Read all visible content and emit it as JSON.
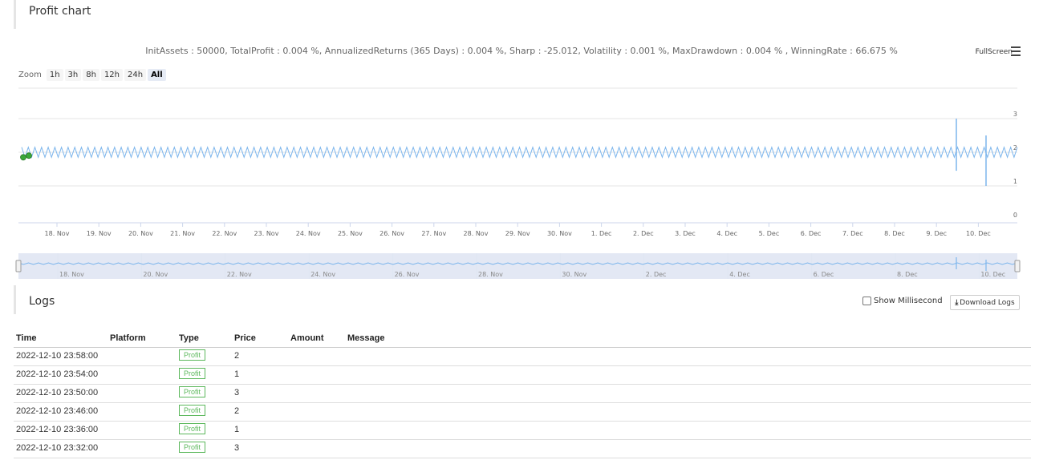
{
  "profit_panel": {
    "title": "Profit chart"
  },
  "stats_line": "InitAssets : 50000, TotalProfit : 0.004 %, AnnualizedReturns (365 Days) : 0.004 %, Sharp : -25.012, Volatility : 0.001 %, MaxDrawdown : 0.004 % , WinningRate : 66.675 %",
  "fullscreen_label": "FullScreen",
  "zoom": {
    "label": "Zoom",
    "buttons": [
      "1h",
      "3h",
      "8h",
      "12h",
      "24h",
      "All"
    ],
    "active": "All"
  },
  "chart_data": {
    "type": "line",
    "series": [
      {
        "values_description": "oscillates between ~1.85 and ~2.15 across entire range, spikes near 9-10 Dec",
        "min": 1,
        "max": 3
      }
    ],
    "ylim": [
      0,
      3
    ],
    "yticks": [
      "0",
      "1",
      "2",
      "3"
    ],
    "xticks": [
      "18. Nov",
      "19. Nov",
      "20. Nov",
      "21. Nov",
      "22. Nov",
      "23. Nov",
      "24. Nov",
      "25. Nov",
      "26. Nov",
      "27. Nov",
      "28. Nov",
      "29. Nov",
      "30. Nov",
      "1. Dec",
      "2. Dec",
      "3. Dec",
      "4. Dec",
      "5. Dec",
      "6. Dec",
      "7. Dec",
      "8. Dec",
      "9. Dec",
      "10. Dec"
    ],
    "navigator_xticks": [
      "18. Nov",
      "20. Nov",
      "22. Nov",
      "24. Nov",
      "26. Nov",
      "28. Nov",
      "30. Nov",
      "2. Dec",
      "4. Dec",
      "6. Dec",
      "8. Dec",
      "10. Dec"
    ],
    "colors": {
      "line": "#7cb5ec",
      "marker": "#3aa83a",
      "navigator_fill": "#ccd6eb"
    }
  },
  "logs_panel": {
    "title": "Logs"
  },
  "show_ms_label": "Show Millisecond",
  "download_label": "Download Logs",
  "logs_table": {
    "headers": [
      "Time",
      "Platform",
      "Type",
      "Price",
      "Amount",
      "Message"
    ],
    "rows": [
      {
        "time": "2022-12-10 23:58:00",
        "platform": "",
        "type": "Profit",
        "price": "2",
        "amount": "",
        "message": ""
      },
      {
        "time": "2022-12-10 23:54:00",
        "platform": "",
        "type": "Profit",
        "price": "1",
        "amount": "",
        "message": ""
      },
      {
        "time": "2022-12-10 23:50:00",
        "platform": "",
        "type": "Profit",
        "price": "3",
        "amount": "",
        "message": ""
      },
      {
        "time": "2022-12-10 23:46:00",
        "platform": "",
        "type": "Profit",
        "price": "2",
        "amount": "",
        "message": ""
      },
      {
        "time": "2022-12-10 23:36:00",
        "platform": "",
        "type": "Profit",
        "price": "1",
        "amount": "",
        "message": ""
      },
      {
        "time": "2022-12-10 23:32:00",
        "platform": "",
        "type": "Profit",
        "price": "3",
        "amount": "",
        "message": ""
      }
    ]
  }
}
